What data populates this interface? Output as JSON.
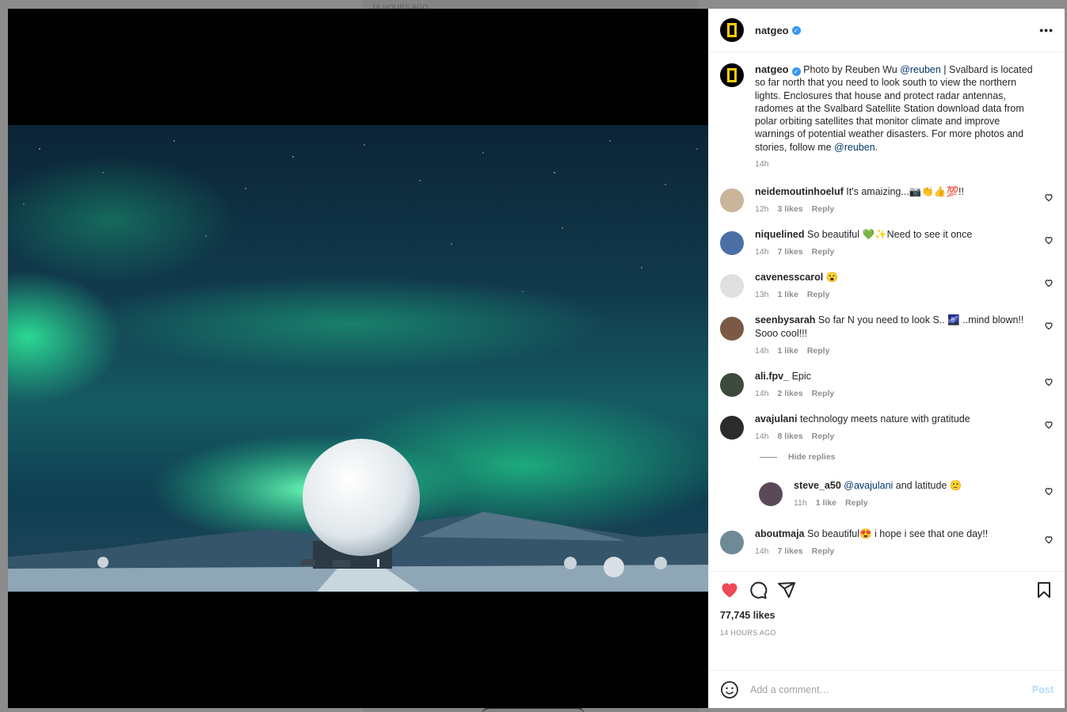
{
  "background": {
    "timestamp": "16 HOURS AGO"
  },
  "post": {
    "author": "natgeo",
    "caption": {
      "username": "natgeo",
      "text_before": "Photo by Reuben Wu ",
      "mention1": "@reuben",
      "text_middle": " | Svalbard is located so far north that you need to look south to view the northern lights. Enclosures that house and protect radar antennas, radomes at the Svalbard Satellite Station download data from polar orbiting satellites that monitor climate and improve warnings of potential weather disasters. For more photos and stories, follow me ",
      "mention2": "@reuben",
      "text_end": ".",
      "time": "14h"
    },
    "comments": [
      {
        "user": "neidemoutinhoeluf",
        "text": "It's amaizing...📷👏👍💯!!",
        "time": "12h",
        "likes": "3 likes",
        "reply": "Reply",
        "avatar_color": "#c9b59a"
      },
      {
        "user": "niquelined",
        "text": "So beautiful 💚✨Need to see it once",
        "time": "14h",
        "likes": "7 likes",
        "reply": "Reply",
        "avatar_color": "#4a6fa5"
      },
      {
        "user": "cavenesscarol",
        "text": "😮",
        "time": "13h",
        "likes": "1 like",
        "reply": "Reply",
        "avatar_color": "#e0e0e0"
      },
      {
        "user": "seenbysarah",
        "text": "So far N you need to look S.. 🌌 ..mind blown!! Sooo cool!!!",
        "time": "14h",
        "likes": "1 like",
        "reply": "Reply",
        "avatar_color": "#7a5a44"
      },
      {
        "user": "ali.fpv_",
        "text": "Epic",
        "time": "14h",
        "likes": "2 likes",
        "reply": "Reply",
        "avatar_color": "#3b4a3a"
      },
      {
        "user": "avajulani",
        "text": "technology meets nature with gratitude",
        "time": "14h",
        "likes": "8 likes",
        "reply": "Reply",
        "avatar_color": "#2b2b2b"
      }
    ],
    "hide_replies": "Hide replies",
    "reply_comment": {
      "user": "steve_a50",
      "mention": "@avajulani",
      "text": " and latitude 🙂",
      "time": "11h",
      "likes": "1 like",
      "reply": "Reply",
      "avatar_color": "#5a4a58"
    },
    "last_comment": {
      "user": "aboutmaja",
      "text": "So beautiful😍 i hope i see that one day!!",
      "time": "14h",
      "likes": "7 likes",
      "reply": "Reply",
      "avatar_color": "#6e8a96"
    },
    "likes_count": "77,745 likes",
    "time_ago": "14 HOURS AGO",
    "add_comment_placeholder": "Add a comment…",
    "post_label": "Post"
  },
  "colors": {
    "accent_link": "#00376b",
    "liked_heart": "#ed4956",
    "verified": "#3897f0",
    "post_disabled": "#b3dbff"
  },
  "icons": [
    "verified-badge-icon",
    "more-options-icon",
    "heart-filled-icon",
    "comment-icon",
    "share-icon",
    "bookmark-icon",
    "emoji-icon",
    "comment-heart-icon"
  ]
}
